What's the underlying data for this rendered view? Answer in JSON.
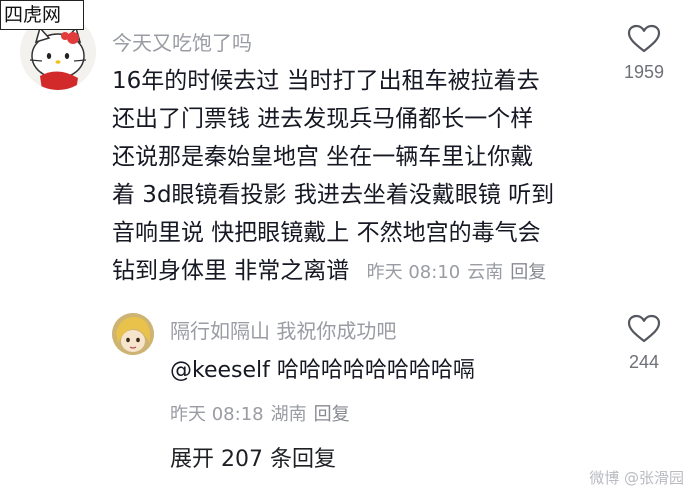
{
  "watermark": {
    "label": "四虎网"
  },
  "comment": {
    "username": "今天又吃饱了吗",
    "lines": [
      "16年的时候去过 当时打了出租车被拉着去",
      "还出了门票钱 进去发现兵马俑都长一个样",
      "还说那是秦始皇地宫 坐在一辆车里让你戴",
      "着 3d眼镜看投影 我进去坐着没戴眼镜 听到",
      "音响里说 快把眼镜戴上 不然地宫的毒气会",
      "钻到身体里 非常之离谱"
    ],
    "time": "昨天 08:10",
    "location": "云南",
    "reply_label": "回复",
    "like_count": "1959"
  },
  "reply": {
    "username": "隔行如隔山 我祝你成功吧",
    "text": "@keeself 哈哈哈哈哈哈哈哈嗝",
    "time": "昨天 08:18",
    "location": "湖南",
    "reply_label": "回复",
    "like_count": "244"
  },
  "expand": {
    "label": "展开 207 条回复"
  },
  "footer_watermark": "微博 @张滑园",
  "colors": {
    "text": "#161823",
    "muted": "#9a9ca3"
  },
  "icons": {
    "like": "heart-outline-icon"
  }
}
